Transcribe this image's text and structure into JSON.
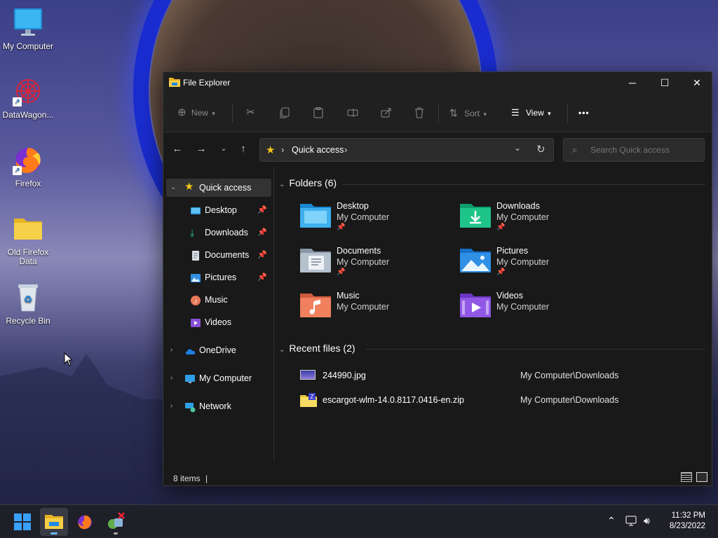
{
  "desktop": {
    "icons": [
      {
        "label": "My Computer"
      },
      {
        "label": "DataWagon..."
      },
      {
        "label": "Firefox"
      },
      {
        "label": "Old Firefox Data"
      },
      {
        "label": "Recycle Bin"
      }
    ]
  },
  "window": {
    "title": "File Explorer",
    "controls": {
      "minimize": "─",
      "maximize": "☐",
      "close": "✕"
    },
    "toolbar": {
      "new_label": "New",
      "sort_label": "Sort",
      "view_label": "View",
      "more_label": "•••"
    },
    "address": {
      "crumb": "Quick access",
      "separator": "›"
    },
    "search": {
      "placeholder": "Search Quick access"
    },
    "sidebar": {
      "quick_access": "Quick access",
      "items": [
        {
          "label": "Desktop",
          "pinned": true
        },
        {
          "label": "Downloads",
          "pinned": true
        },
        {
          "label": "Documents",
          "pinned": true
        },
        {
          "label": "Pictures",
          "pinned": true
        },
        {
          "label": "Music",
          "pinned": false
        },
        {
          "label": "Videos",
          "pinned": false
        }
      ],
      "onedrive": "OneDrive",
      "my_computer": "My Computer",
      "network": "Network"
    },
    "folders_header": "Folders (6)",
    "folders": [
      {
        "name": "Desktop",
        "location": "My Computer",
        "pinned": true
      },
      {
        "name": "Downloads",
        "location": "My Computer",
        "pinned": true
      },
      {
        "name": "Documents",
        "location": "My Computer",
        "pinned": true
      },
      {
        "name": "Pictures",
        "location": "My Computer",
        "pinned": true
      },
      {
        "name": "Music",
        "location": "My Computer",
        "pinned": false
      },
      {
        "name": "Videos",
        "location": "My Computer",
        "pinned": false
      }
    ],
    "recent_header": "Recent files (2)",
    "recent": [
      {
        "name": "244990.jpg",
        "path": "My Computer\\Downloads"
      },
      {
        "name": "escargot-wlm-14.0.8117.0416-en.zip",
        "path": "My Computer\\Downloads"
      }
    ],
    "status": {
      "items": "8 items",
      "cursor": "|"
    }
  },
  "taskbar": {
    "tray_icons": [
      "chevron-up-icon",
      "network-icon",
      "volume-icon"
    ],
    "time": "11:32 PM",
    "date": "8/23/2022"
  },
  "colors": {
    "accent": "#6ab4ff",
    "window_bg": "#191919",
    "toolbar_bg": "#202020"
  }
}
